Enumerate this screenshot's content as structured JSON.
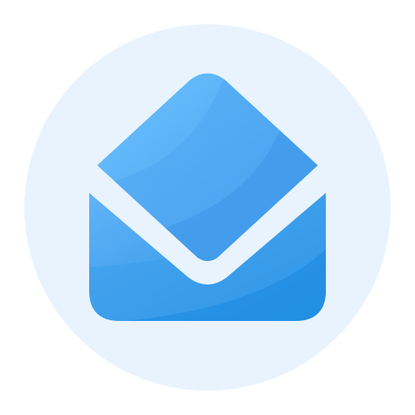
{
  "icon": {
    "name": "open-envelope-icon",
    "colors": {
      "backdrop": "#E8F3FD",
      "flap_light": "#6EC3FF",
      "flap_dark": "#3F9AEA",
      "body_light": "#62B2F6",
      "body_dark": "#1F8FE3",
      "separator": "#E8F3FD"
    }
  }
}
